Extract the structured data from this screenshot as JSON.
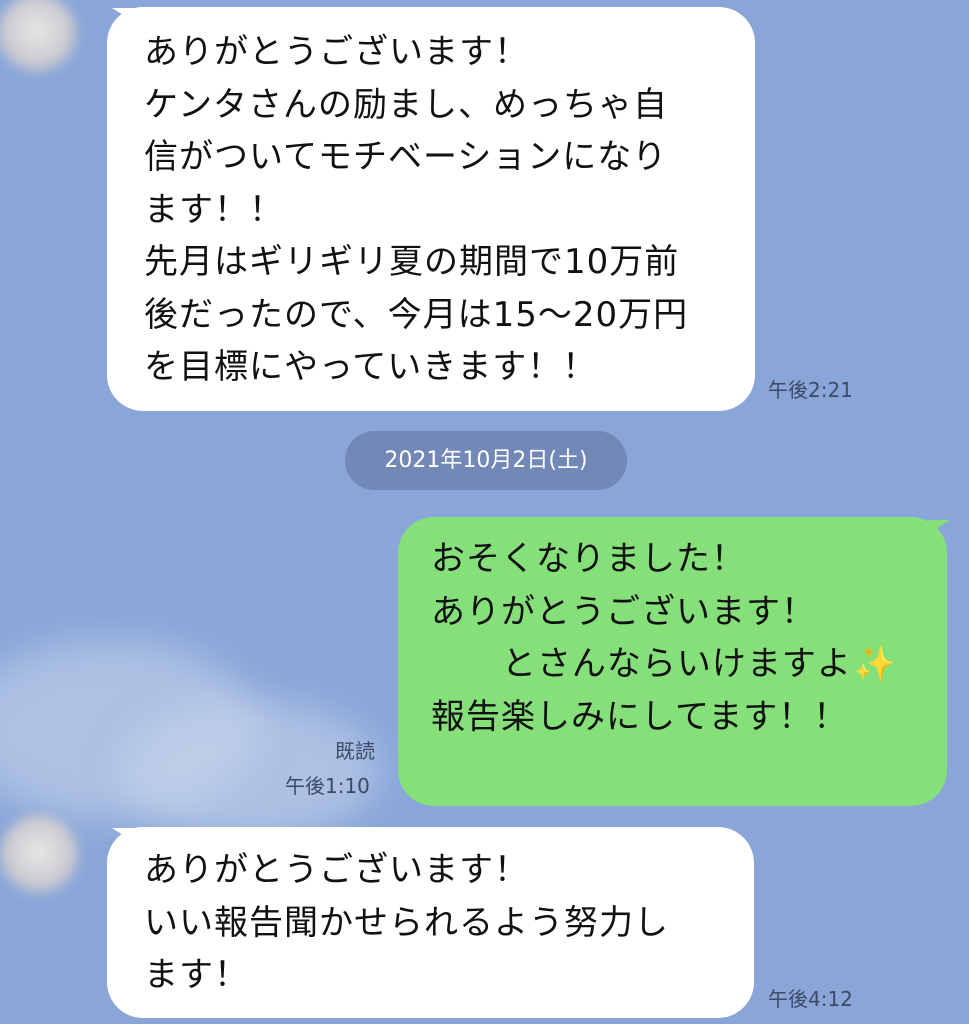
{
  "chat": {
    "messages": [
      {
        "lines": [
          "ありがとうございます！",
          "ケンタさんの励まし、めっちゃ自",
          "信がついてモチベーションになり",
          "ます！！",
          "先月はギリギリ夏の期間で10万前",
          "後だったので、今月は15〜20万円",
          "を目標にやっていきます！！"
        ],
        "time": "午後2:21"
      },
      {
        "lines": [
          "おそくなりました！",
          "ありがとうございます！",
          "      とさんならいけますよ",
          "",
          "報告楽しみにしてます！！"
        ],
        "emoji": "✨",
        "read": "既読",
        "time": "午後1:10"
      },
      {
        "lines": [
          "ありがとうございます！",
          "いい報告聞かせられるよう努力し",
          "ます！"
        ],
        "time": "午後4:12"
      }
    ],
    "date_separator": "2021年10月2日(土)"
  },
  "colors": {
    "background": "#8aa6d9",
    "incoming_bubble": "#ffffff",
    "outgoing_bubble": "#85e07a",
    "date_pill": "#7288b6"
  }
}
